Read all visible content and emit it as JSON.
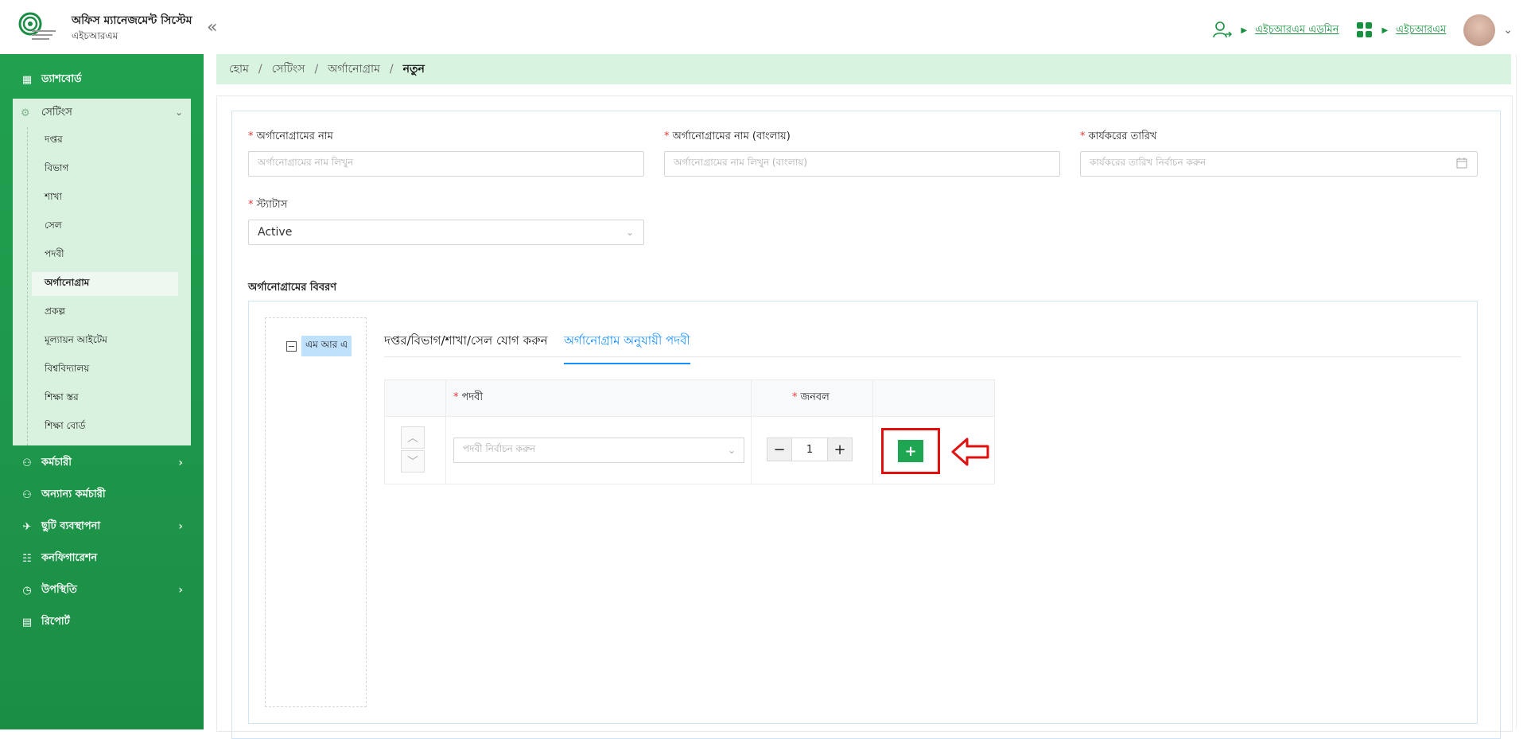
{
  "header": {
    "app_title": "অফিস ম্যানেজমেন্ট সিস্টেম",
    "app_subtitle": "এইচআরএম",
    "user_role_link": "এইচআরএম এডমিন",
    "module_link": "এইচআরএম"
  },
  "sidebar": {
    "dashboard": "ড্যাশবোর্ড",
    "settings": "সেটিংস",
    "settings_items": [
      "দপ্তর",
      "বিভাগ",
      "শাখা",
      "সেল",
      "পদবী",
      "অর্গানোগ্রাম",
      "প্রকল্প",
      "মূল্যায়ন আইটেম",
      "বিশ্ববিদ্যালয়",
      "শিক্ষা স্তর",
      "শিক্ষা বোর্ড"
    ],
    "active_settings_item": "অর্গানোগ্রাম",
    "employee": "কর্মচারী",
    "other_employee": "অন্যান্য কর্মচারী",
    "leave": "ছুটি ব্যবস্থাপনা",
    "configuration": "কনফিগারেশন",
    "attendance": "উপস্থিতি",
    "report": "রিপোর্ট"
  },
  "breadcrumb": {
    "home": "হোম",
    "settings": "সেটিংস",
    "organogram": "অর্গানোগ্রাম",
    "current": "নতুন"
  },
  "form": {
    "name_label": "অর্গানোগ্রামের নাম",
    "name_placeholder": "অর্গানোগ্রামের নাম লিখুন",
    "name_bn_label": "অর্গানোগ্রামের নাম (বাংলায়)",
    "name_bn_placeholder": "অর্গানোগ্রামের নাম লিখুন (বাংলায়)",
    "date_label": "কার্যকরের তারিখ",
    "date_placeholder": "কার্যকরের তারিখ নির্বাচন করুন",
    "status_label": "স্ট্যাটাস",
    "status_value": "Active",
    "required_mark": "*"
  },
  "details": {
    "section_title": "অর্গানোগ্রামের বিবরণ",
    "tree_root": "এম আর এ",
    "tabs": [
      "দপ্তর/বিভাগ/শাখা/সেল যোগ করুন",
      "অর্গানোগ্রাম অনুযায়ী পদবী"
    ],
    "active_tab": 1,
    "grid": {
      "col_designation": "পদবী",
      "col_manpower": "জনবল",
      "designation_placeholder": "পদবী নির্বাচন করুন",
      "manpower_value": "1"
    }
  },
  "colors": {
    "sidebar_green": "#21a150",
    "accent_blue": "#1890ff",
    "highlight_red": "#e01010",
    "breadcrumb_bg": "#d8f3e0"
  }
}
